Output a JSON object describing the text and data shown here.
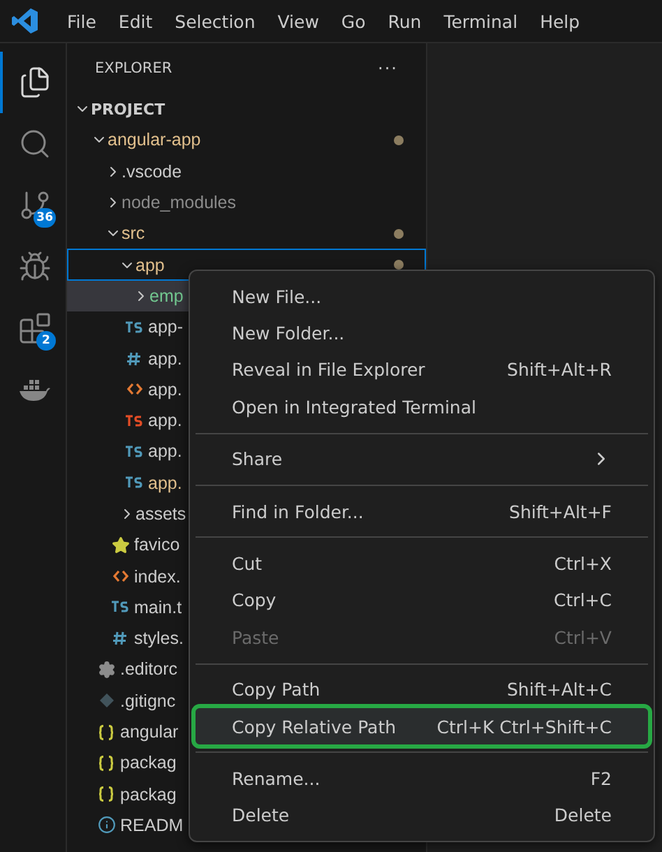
{
  "menu_bar": [
    "File",
    "Edit",
    "Selection",
    "View",
    "Go",
    "Run",
    "Terminal",
    "Help"
  ],
  "activity_bar": [
    {
      "kind": "files",
      "selected": true
    },
    {
      "kind": "search",
      "selected": false
    },
    {
      "kind": "source-control",
      "selected": false,
      "badge": "36"
    },
    {
      "kind": "run",
      "selected": false
    },
    {
      "kind": "extensions",
      "selected": false,
      "badge": "2"
    },
    {
      "kind": "docker",
      "selected": false
    }
  ],
  "sidebar": {
    "title": "EXPLORER",
    "more": "···",
    "section": {
      "title": "PROJECT",
      "expanded": true
    },
    "tree": [
      {
        "kind": "folder",
        "label": "angular-app",
        "expanded": true,
        "color": "#e2c08d",
        "dot": true,
        "selected": false,
        "hover": false,
        "children": [
          {
            "kind": "folder",
            "label": ".vscode",
            "expanded": false,
            "color": "#cccccc",
            "dot": false,
            "selected": false,
            "hover": false
          },
          {
            "kind": "folder",
            "label": "node_modules",
            "expanded": false,
            "color": "#8c8c8c",
            "dot": false,
            "selected": false,
            "hover": false
          },
          {
            "kind": "folder",
            "label": "src",
            "expanded": true,
            "color": "#e2c08d",
            "dot": true,
            "selected": false,
            "hover": false,
            "children": [
              {
                "kind": "folder",
                "label": "app",
                "expanded": true,
                "color": "#e2c08d",
                "dot": true,
                "selected": true,
                "hover": false,
                "children": [
                  {
                    "kind": "folder",
                    "label": "emp",
                    "expanded": false,
                    "color": "#73c991",
                    "selected": false,
                    "hover": true
                  },
                  {
                    "kind": "ts",
                    "label": "app-",
                    "color": "#cccccc",
                    "selected": false,
                    "hover": false
                  },
                  {
                    "kind": "css",
                    "label": "app.",
                    "color": "#cccccc",
                    "selected": false,
                    "hover": false
                  },
                  {
                    "kind": "html",
                    "label": "app.",
                    "color": "#cccccc",
                    "selected": false,
                    "hover": false
                  },
                  {
                    "kind": "ts-red",
                    "label": "app.",
                    "color": "#cccccc",
                    "selected": false,
                    "hover": false
                  },
                  {
                    "kind": "ts",
                    "label": "app.",
                    "color": "#cccccc",
                    "selected": false,
                    "hover": false
                  },
                  {
                    "kind": "ts",
                    "label": "app.",
                    "color": "#e2c08d",
                    "selected": false,
                    "hover": false
                  }
                ]
              },
              {
                "kind": "folder",
                "label": "assets",
                "expanded": false,
                "color": "#cccccc",
                "selected": false,
                "hover": false
              },
              {
                "kind": "star",
                "label": "favico",
                "color": "#cccccc",
                "selected": false,
                "hover": false
              },
              {
                "kind": "html",
                "label": "index.",
                "color": "#cccccc",
                "selected": false,
                "hover": false
              },
              {
                "kind": "ts",
                "label": "main.t",
                "color": "#cccccc",
                "selected": false,
                "hover": false
              },
              {
                "kind": "css",
                "label": "styles.",
                "color": "#cccccc",
                "selected": false,
                "hover": false
              }
            ]
          },
          {
            "kind": "gear",
            "label": ".editorc",
            "color": "#cccccc",
            "selected": false,
            "hover": false
          },
          {
            "kind": "git",
            "label": ".gitignc",
            "color": "#cccccc",
            "selected": false,
            "hover": false
          },
          {
            "kind": "json",
            "label": "angular",
            "color": "#cccccc",
            "selected": false,
            "hover": false
          },
          {
            "kind": "json",
            "label": "packag",
            "color": "#cccccc",
            "selected": false,
            "hover": false
          },
          {
            "kind": "json",
            "label": "packag",
            "color": "#cccccc",
            "selected": false,
            "hover": false
          },
          {
            "kind": "info",
            "label": "READM",
            "color": "#cccccc",
            "selected": false,
            "hover": false
          }
        ]
      }
    ]
  },
  "context_menu": [
    [
      {
        "label": "New File...",
        "selected": false,
        "disabled": false
      },
      {
        "label": "New Folder...",
        "selected": false,
        "disabled": false
      },
      {
        "label": "Reveal in File Explorer",
        "shortcut": "Shift+Alt+R",
        "selected": false,
        "disabled": false
      },
      {
        "label": "Open in Integrated Terminal",
        "selected": false,
        "disabled": false
      }
    ],
    [
      {
        "label": "Share",
        "submenu": true,
        "selected": false,
        "disabled": false
      }
    ],
    [
      {
        "label": "Find in Folder...",
        "shortcut": "Shift+Alt+F",
        "selected": false,
        "disabled": false
      }
    ],
    [
      {
        "label": "Cut",
        "shortcut": "Ctrl+X",
        "selected": false,
        "disabled": false
      },
      {
        "label": "Copy",
        "shortcut": "Ctrl+C",
        "selected": false,
        "disabled": false
      },
      {
        "label": "Paste",
        "shortcut": "Ctrl+V",
        "selected": false,
        "disabled": true
      }
    ],
    [
      {
        "label": "Copy Path",
        "shortcut": "Shift+Alt+C",
        "selected": false,
        "disabled": false
      },
      {
        "label": "Copy Relative Path",
        "shortcut": "Ctrl+K Ctrl+Shift+C",
        "selected": true,
        "disabled": false
      }
    ],
    [
      {
        "label": "Rename...",
        "shortcut": "F2",
        "selected": false,
        "disabled": false
      },
      {
        "label": "Delete",
        "shortcut": "Delete",
        "selected": false,
        "disabled": false
      }
    ]
  ]
}
